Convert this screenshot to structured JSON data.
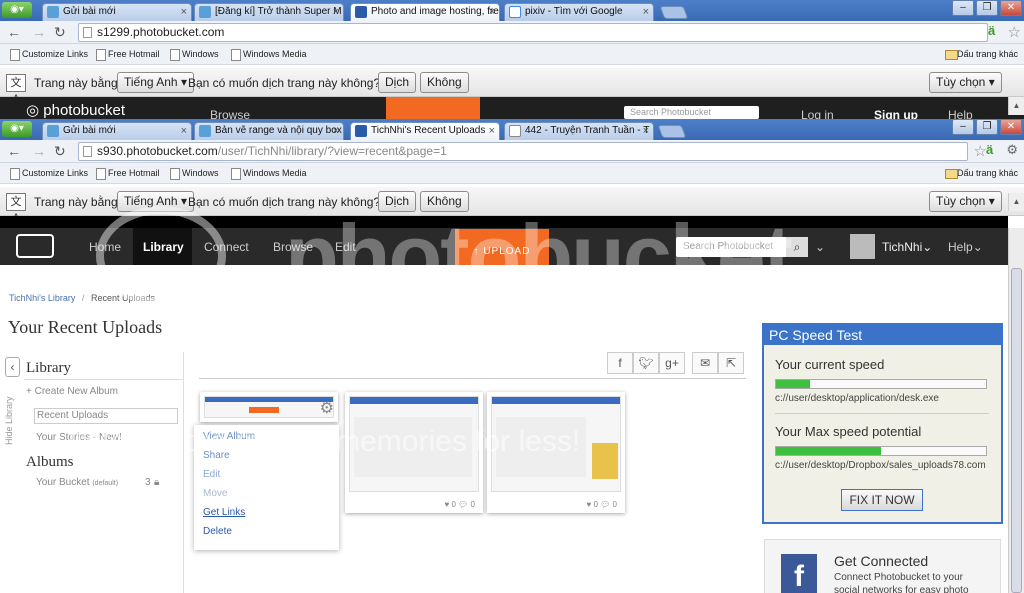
{
  "top_window": {
    "tabs": [
      {
        "label": "Gửi bài mới"
      },
      {
        "label": "[Đăng kí] Trở thành Super M"
      },
      {
        "label": "Photo and image hosting, fre"
      },
      {
        "label": "pixiv - Tìm với Google"
      }
    ],
    "url": "s1299.photobucket.com",
    "bookmarks": [
      "Customize Links",
      "Free Hotmail",
      "Windows",
      "Windows Media"
    ],
    "other_bookmarks": "Dấu trang khác",
    "translate": {
      "prefix": "Trang này bằng",
      "language": "Tiếng Anh",
      "question": "Bạn có muốn dịch trang này không?",
      "translate_btn": "Dịch",
      "no_btn": "Không",
      "options_btn": "Tùy chọn"
    },
    "nav": {
      "logo": "photobucket",
      "browse": "Browse",
      "upload": "UPLOAD",
      "search_placeholder": "Search Photobucket",
      "login": "Log in",
      "signup": "Sign up",
      "help": "Help"
    }
  },
  "bottom_window": {
    "tabs": [
      {
        "label": "Gửi bài mới"
      },
      {
        "label": "Bản vẽ range và nội quy box"
      },
      {
        "label": "TichNhi's Recent Uploads"
      },
      {
        "label": "442 - Truyện Tranh Tuần - T"
      }
    ],
    "url_host": "s930.photobucket.com",
    "url_path": "/user/TichNhi/library/?view=recent&page=1",
    "bookmarks": [
      "Customize Links",
      "Free Hotmail",
      "Windows",
      "Windows Media"
    ],
    "other_bookmarks": "Dấu trang khác",
    "translate": {
      "prefix": "Trang này bằng",
      "language": "Tiếng Anh",
      "question": "Bạn có muốn dịch trang này không?",
      "translate_btn": "Dịch",
      "no_btn": "Không",
      "options_btn": "Tùy chọn"
    }
  },
  "site": {
    "nav": [
      "Home",
      "Library",
      "Connect",
      "Browse",
      "Edit"
    ],
    "upload": "UPLOAD",
    "search_placeholder": "Search Photobucket",
    "user": "TichNhi",
    "help": "Help"
  },
  "page": {
    "breadcrumb_root": "TichNhi's Library",
    "breadcrumb_sep": "/",
    "breadcrumb_current": "Recent Uploads",
    "title": "Your Recent Uploads"
  },
  "sidebar": {
    "hide_label": "Hide Library",
    "library": "Library",
    "create_album": "Create New Album",
    "recent_uploads": "Recent Uploads",
    "your_stories": "Your Stories - New!",
    "albums": "Albums",
    "bucket": "Your Bucket",
    "bucket_default": "(default)",
    "bucket_count": "3"
  },
  "context_menu": [
    "View Album",
    "Share",
    "Edit",
    "Move",
    "Get Links",
    "Delete"
  ],
  "thumbs": [
    {
      "likes": "0",
      "comments": "0"
    },
    {
      "likes": "0",
      "comments": "0"
    }
  ],
  "ad": {
    "title": "PC Speed Test",
    "current_label": "Your current speed",
    "current_fraction": 0.16,
    "current_path": "c://user/desktop/application/desk.exe",
    "max_label": "Your Max speed potential",
    "max_fraction": 0.5,
    "max_path": "c://user/desktop/Dropbox/sales_uploads78.com",
    "button": "FIX IT NOW"
  },
  "get_connected": {
    "title": "Get Connected",
    "text_1": "Connect Photobucket to your",
    "text_2": "social networks for easy photo"
  },
  "watermark": {
    "word": "photobucket",
    "protect": "Protect more of your memories for less!"
  }
}
